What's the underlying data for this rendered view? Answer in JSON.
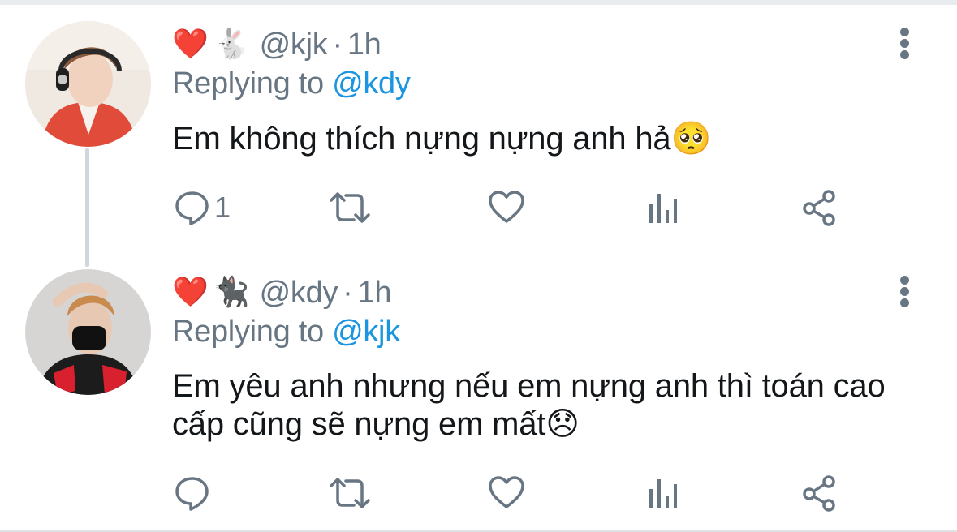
{
  "thread": [
    {
      "name_emojis": [
        "❤️",
        "🐇"
      ],
      "handle": "@kjk",
      "separator": "·",
      "time": "1h",
      "replying_prefix": "Replying to",
      "replying_to": "@kdy",
      "text": "Em không thích nựng nựng anh hả🥺",
      "actions": {
        "reply_count": "1"
      }
    },
    {
      "name_emojis": [
        "❤️",
        "🐈‍⬛"
      ],
      "handle": "@kdy",
      "separator": "·",
      "time": "1h",
      "replying_prefix": "Replying to",
      "replying_to": "@kjk",
      "text": "Em yêu anh nhưng nếu em nựng anh thì toán cao cấp cũng sẽ nựng em mất😞",
      "actions": {
        "reply_count": ""
      }
    }
  ],
  "icons": {
    "reply": "reply-icon",
    "retweet": "retweet-icon",
    "like": "heart-icon",
    "analytics": "analytics-icon",
    "share": "share-icon",
    "more": "more-vertical-icon"
  },
  "colors": {
    "text_primary": "#14171a",
    "text_secondary": "#687684",
    "mention": "#1b95e0",
    "heart": "#e0245e",
    "thread_line": "#cfd6dc"
  }
}
